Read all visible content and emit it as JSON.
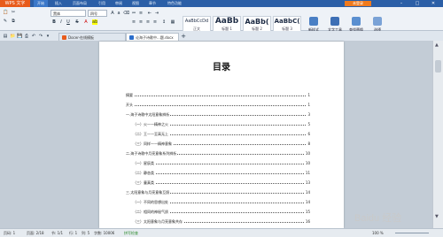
{
  "app": {
    "logo": "WPS 文字"
  },
  "menu": {
    "items": [
      "开始",
      "插入",
      "页面布局",
      "引用",
      "审阅",
      "视图",
      "章节",
      "特色功能"
    ],
    "active_index": 0,
    "login": "未登录"
  },
  "ribbon": {
    "font_name": "黑体",
    "font_size": "四号",
    "styles": [
      {
        "preview": "AaBbCcDd",
        "label": "正文"
      },
      {
        "preview": "AaBb",
        "label": "标题 1"
      },
      {
        "preview": "AaBb(",
        "label": "标题 2"
      },
      {
        "preview": "AaBbC(",
        "label": "标题 3"
      }
    ],
    "tools": [
      "新样式",
      "文字工具",
      "查找替换",
      "选择"
    ]
  },
  "tabs": [
    {
      "label": "Docer-在线模板",
      "active": false
    },
    {
      "label": "论海子诗歌中...题.docx",
      "active": true
    }
  ],
  "document": {
    "title": "目录",
    "toc": [
      {
        "text": "摘要",
        "page": "1",
        "indent": 0
      },
      {
        "text": "开头",
        "page": "1",
        "indent": 0
      },
      {
        "text": "一.海子诗歌中太阳意象辨析",
        "page": "3",
        "indent": 0
      },
      {
        "text": "（一）火——精神之火",
        "page": "5",
        "indent": 1
      },
      {
        "text": "（二）王——至高无上",
        "page": "6",
        "indent": 1
      },
      {
        "text": "（三）同样——精神意象",
        "page": "8",
        "indent": 1
      },
      {
        "text": "二.海子诗歌中月亮意象系列辨析",
        "page": "10",
        "indent": 0
      },
      {
        "text": "（一）星辰类",
        "page": "10",
        "indent": 1
      },
      {
        "text": "（二）静态类",
        "page": "11",
        "indent": 1
      },
      {
        "text": "（三）童真类",
        "page": "13",
        "indent": 1
      },
      {
        "text": "三.太阳意象与月亮意象互照",
        "page": "14",
        "indent": 0
      },
      {
        "text": "（一）不同的思想出处",
        "page": "14",
        "indent": 1
      },
      {
        "text": "（二）相同的神秘气质",
        "page": "15",
        "indent": 1
      },
      {
        "text": "（三）太阳意象与月亮意象共存",
        "page": "16",
        "indent": 1
      }
    ]
  },
  "status": {
    "page_num": "页码: 1",
    "page": "页面: 2/18",
    "section": "节: 1/1",
    "row": "行: 1",
    "col": "列: 5",
    "words": "字数: 10006",
    "spell": "拼写检查",
    "zoom": "100 %"
  },
  "watermark": "Baidu 经验"
}
